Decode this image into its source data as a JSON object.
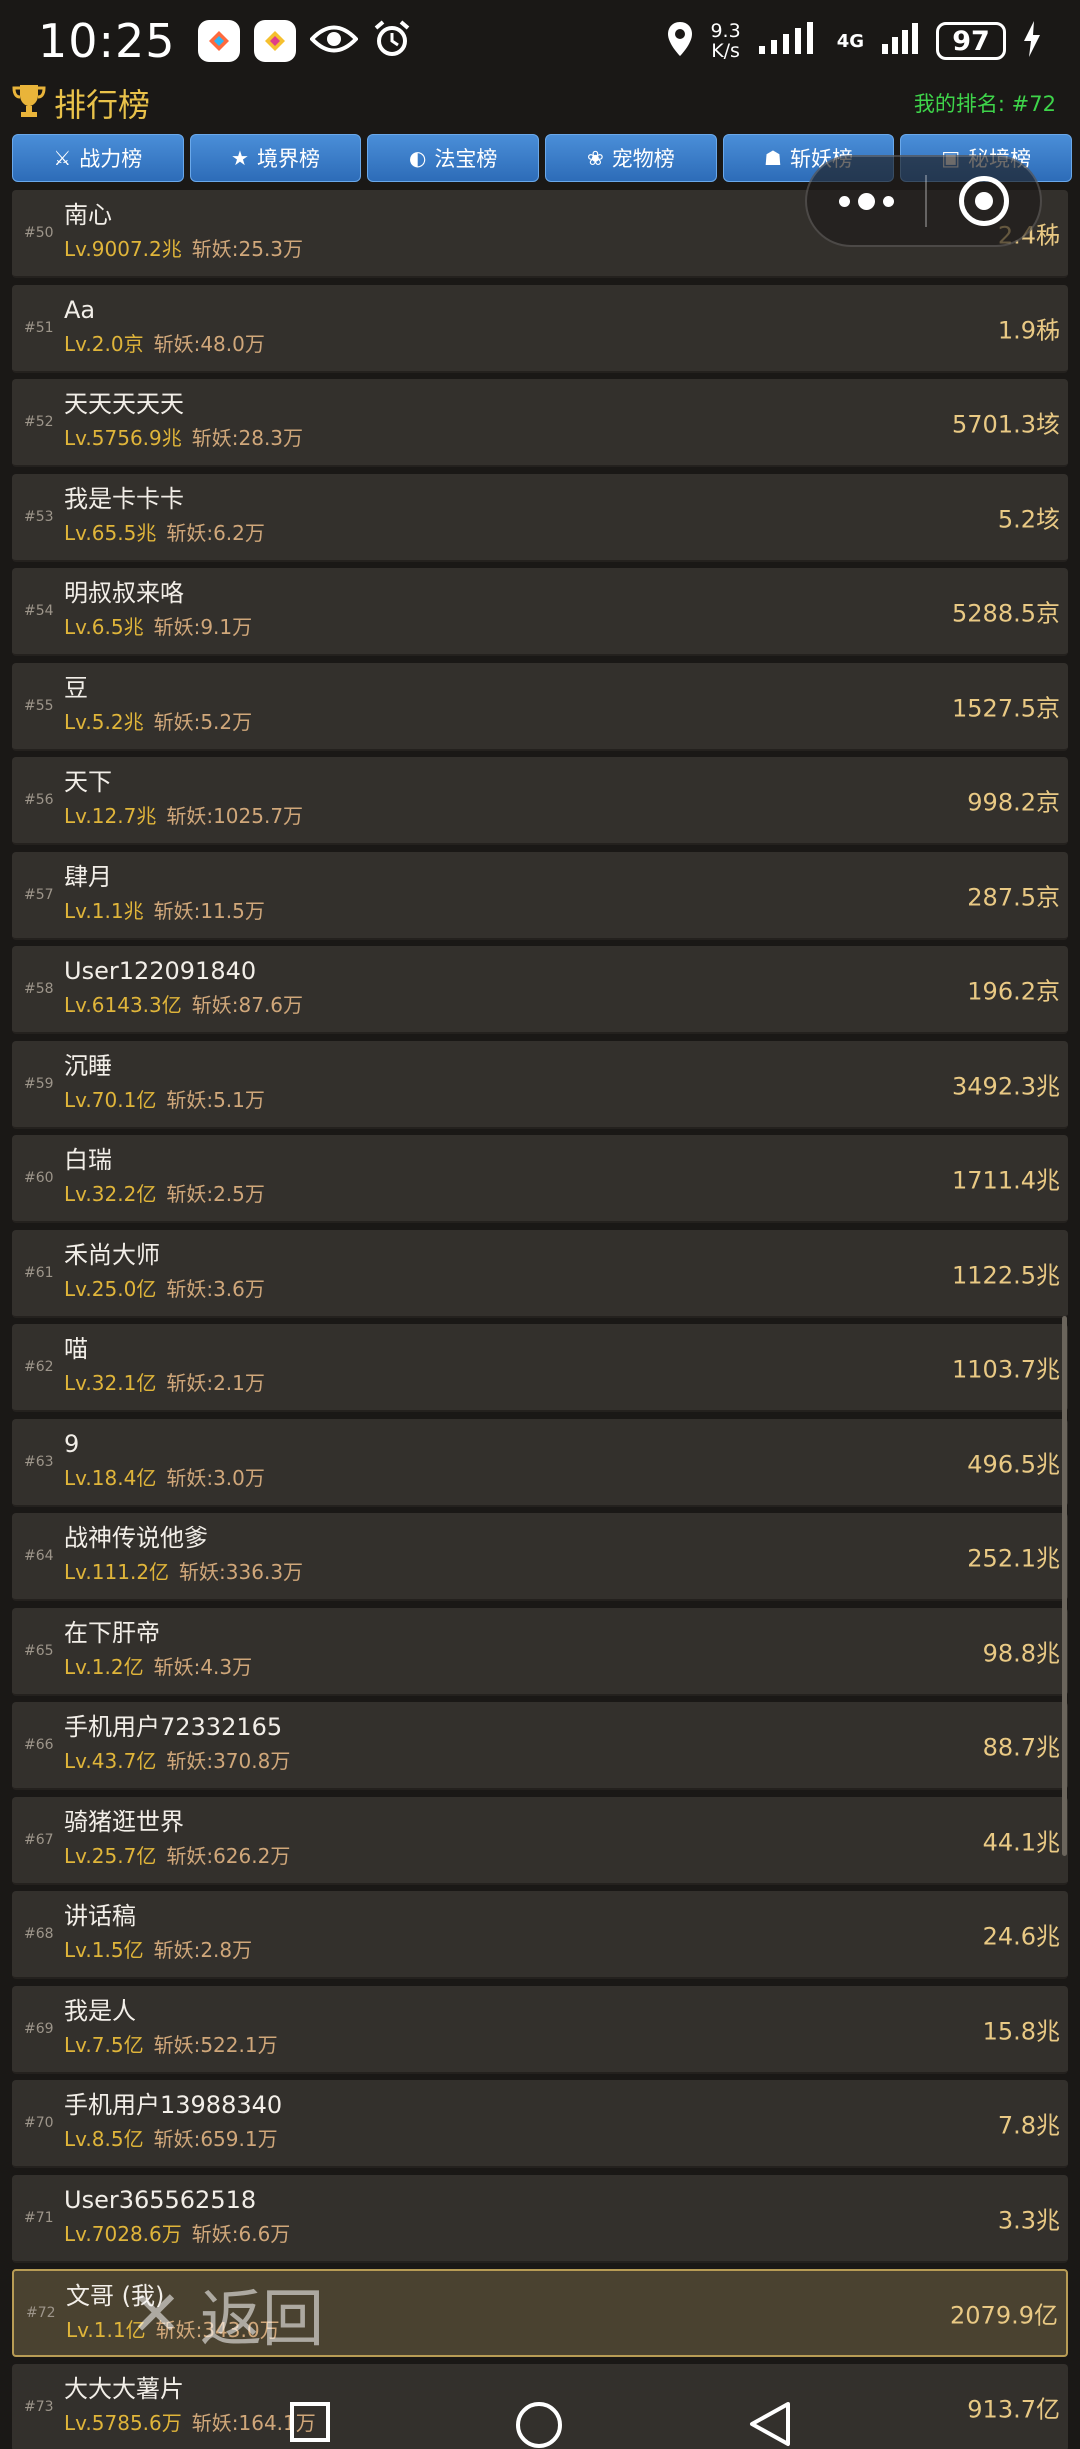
{
  "status_bar": {
    "time": "10:25",
    "speed_value": "9.3",
    "speed_unit": "K/s",
    "network": "4G",
    "battery": "97"
  },
  "header": {
    "title": "排行榜",
    "my_rank": "我的排名: #72"
  },
  "tabs": [
    {
      "icon": "⚔",
      "label": "战力榜"
    },
    {
      "icon": "★",
      "label": "境界榜"
    },
    {
      "icon": "◐",
      "label": "法宝榜"
    },
    {
      "icon": "❀",
      "label": "宠物榜"
    },
    {
      "icon": "☗",
      "label": "斩妖榜"
    },
    {
      "icon": "▣",
      "label": "秘境榜"
    }
  ],
  "rows": [
    {
      "rank": "#50",
      "name": "南心",
      "lv": "Lv.9007.2兆",
      "kill": "斩妖:25.3万",
      "value": "2.4秭"
    },
    {
      "rank": "#51",
      "name": "Aa",
      "lv": "Lv.2.0京",
      "kill": "斩妖:48.0万",
      "value": "1.9秭"
    },
    {
      "rank": "#52",
      "name": "天天天天天",
      "lv": "Lv.5756.9兆",
      "kill": "斩妖:28.3万",
      "value": "5701.3垓"
    },
    {
      "rank": "#53",
      "name": "我是卡卡卡",
      "lv": "Lv.65.5兆",
      "kill": "斩妖:6.2万",
      "value": "5.2垓"
    },
    {
      "rank": "#54",
      "name": "明叔叔来咯",
      "lv": "Lv.6.5兆",
      "kill": "斩妖:9.1万",
      "value": "5288.5京"
    },
    {
      "rank": "#55",
      "name": "豆",
      "lv": "Lv.5.2兆",
      "kill": "斩妖:5.2万",
      "value": "1527.5京"
    },
    {
      "rank": "#56",
      "name": "天下",
      "lv": "Lv.12.7兆",
      "kill": "斩妖:1025.7万",
      "value": "998.2京"
    },
    {
      "rank": "#57",
      "name": "肆月",
      "lv": "Lv.1.1兆",
      "kill": "斩妖:11.5万",
      "value": "287.5京"
    },
    {
      "rank": "#58",
      "name": "User122091840",
      "lv": "Lv.6143.3亿",
      "kill": "斩妖:87.6万",
      "value": "196.2京"
    },
    {
      "rank": "#59",
      "name": "沉睡",
      "lv": "Lv.70.1亿",
      "kill": "斩妖:5.1万",
      "value": "3492.3兆"
    },
    {
      "rank": "#60",
      "name": "白瑞",
      "lv": "Lv.32.2亿",
      "kill": "斩妖:2.5万",
      "value": "1711.4兆"
    },
    {
      "rank": "#61",
      "name": "禾尚大师",
      "lv": "Lv.25.0亿",
      "kill": "斩妖:3.6万",
      "value": "1122.5兆"
    },
    {
      "rank": "#62",
      "name": "喵",
      "lv": "Lv.32.1亿",
      "kill": "斩妖:2.1万",
      "value": "1103.7兆"
    },
    {
      "rank": "#63",
      "name": "9",
      "lv": "Lv.18.4亿",
      "kill": "斩妖:3.0万",
      "value": "496.5兆"
    },
    {
      "rank": "#64",
      "name": "战神传说他爹",
      "lv": "Lv.111.2亿",
      "kill": "斩妖:336.3万",
      "value": "252.1兆"
    },
    {
      "rank": "#65",
      "name": "在下肝帝",
      "lv": "Lv.1.2亿",
      "kill": "斩妖:4.3万",
      "value": "98.8兆"
    },
    {
      "rank": "#66",
      "name": "手机用户72332165",
      "lv": "Lv.43.7亿",
      "kill": "斩妖:370.8万",
      "value": "88.7兆"
    },
    {
      "rank": "#67",
      "name": "骑猪逛世界",
      "lv": "Lv.25.7亿",
      "kill": "斩妖:626.2万",
      "value": "44.1兆"
    },
    {
      "rank": "#68",
      "name": "讲话稿",
      "lv": "Lv.1.5亿",
      "kill": "斩妖:2.8万",
      "value": "24.6兆"
    },
    {
      "rank": "#69",
      "name": "我是人",
      "lv": "Lv.7.5亿",
      "kill": "斩妖:522.1万",
      "value": "15.8兆"
    },
    {
      "rank": "#70",
      "name": "手机用户13988340",
      "lv": "Lv.8.5亿",
      "kill": "斩妖:659.1万",
      "value": "7.8兆"
    },
    {
      "rank": "#71",
      "name": "User365562518",
      "lv": "Lv.7028.6万",
      "kill": "斩妖:6.6万",
      "value": "3.3兆"
    },
    {
      "rank": "#72",
      "name": "文哥 (我)",
      "lv": "Lv.1.1亿",
      "kill": "斩妖:343.0万",
      "value": "2079.9亿",
      "me": true
    },
    {
      "rank": "#73",
      "name": "大大大薯片",
      "lv": "Lv.5785.6万",
      "kill": "斩妖:164.1万",
      "value": "913.7亿"
    }
  ],
  "back_button": {
    "label": "返回"
  }
}
